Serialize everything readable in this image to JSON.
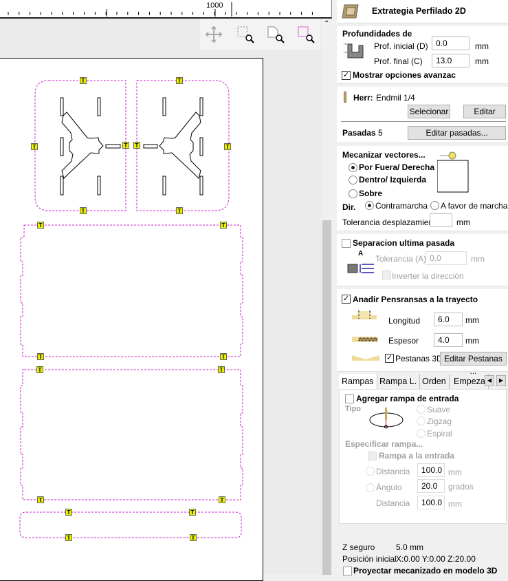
{
  "ruler": {
    "label": "1000"
  },
  "canvas": {
    "tab_marker_label": "T",
    "toolpath_color": "#d020d0",
    "tab_color": "#e8f000"
  },
  "zoom_toolbar": {
    "items": [
      "pan-icon",
      "zoom-box-icon",
      "zoom-page-icon",
      "zoom-selection-icon"
    ]
  },
  "panel": {
    "title": "Extrategia Perfilado 2D",
    "depths": {
      "heading": "Profundidades de",
      "start_label": "Prof. inicial (D)",
      "start_value": "0.0",
      "end_label": "Prof. final (C)",
      "end_value": "13.0",
      "unit": "mm",
      "advanced_label": "Mostrar opciones avanzac",
      "advanced_checked": true
    },
    "tool": {
      "label": "Herr:",
      "name": "Endmil 1/4",
      "select_button": "Selecionar",
      "edit_button": "Editar"
    },
    "passes": {
      "label": "Pasadas",
      "count": "5",
      "edit_button": "Editar pasadas..."
    },
    "machine": {
      "heading": "Mecanizar vectores...",
      "options": [
        "Por Fuera/ Derecha",
        "Dentro/ Izquierda",
        "Sobre"
      ],
      "selected": 0,
      "dir_label": "Dir.",
      "dir_options": [
        "Contramarcha",
        "A favor de marcha"
      ],
      "dir_selected": 0,
      "tolerance_label": "Tolerancia desplazamiento",
      "tolerance_value": "",
      "unit": "mm"
    },
    "separation": {
      "label": "Separacion ultima pasada",
      "checked": false,
      "tolerance_label": "Tolerancia (A)",
      "tolerance_value": "0.0",
      "unit": "mm",
      "invert_label": "Inverter la dirección",
      "letter": "A"
    },
    "tabs": {
      "label": "Anadir Pensransas a la trayecto",
      "checked": true,
      "length_label": "Longitud",
      "length_value": "6.0",
      "thickness_label": "Espesor",
      "thickness_value": "4.0",
      "unit": "mm",
      "tabs3d_label": "Pestanas 3D",
      "edit_button": "Editar Pestanas ..."
    },
    "tabstrip": {
      "tabs": [
        "Rampas",
        "Rampa L.",
        "Orden",
        "Empeza"
      ],
      "active": 0
    },
    "ramps": {
      "add_label": "Agregar rampa de entrada",
      "type_label": "Tipo",
      "types": [
        "Suave",
        "Zigzag",
        "Espiral"
      ],
      "specify_label": "Especificar rampa...",
      "ramp_in_label": "Rampa a la entrada",
      "distance_label": "Distancia",
      "distance_value": "100.0",
      "angle_label": "Ángulo",
      "angle_value": "20.0",
      "angle_unit": "grados",
      "distance2_label": "Distancia",
      "distance2_value": "100.0",
      "unit": "mm"
    },
    "footer": {
      "safe_z_label": "Z seguro",
      "safe_z_value": "5.0 mm",
      "home_label": "Posición inicial",
      "home_value": "X:0.00 Y:0.00 Z:20.00",
      "project_label": "Proyectar mecanizado en modelo 3D"
    }
  }
}
